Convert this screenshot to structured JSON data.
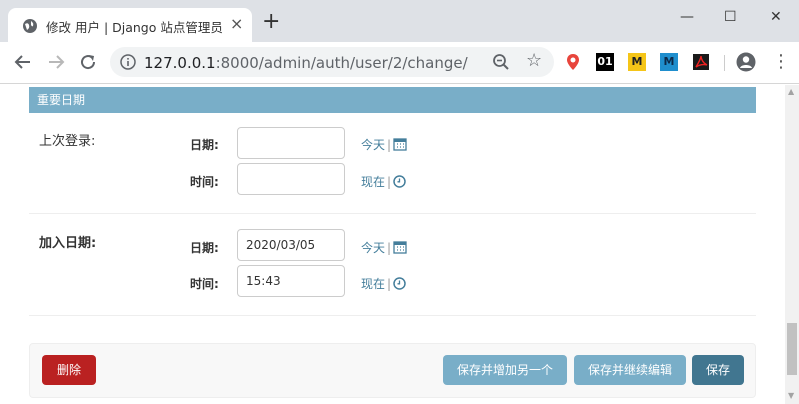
{
  "browser": {
    "tab_title": "修改 用户 | Django 站点管理员",
    "tab_close": "×",
    "new_tab": "+",
    "window": {
      "minimize": "—",
      "maximize": "☐",
      "close": "✕"
    },
    "url_host": "127.0.0.1",
    "url_rest": ":8000/admin/auth/user/2/change/",
    "extensions": [
      {
        "name": "01",
        "bg": "#000000",
        "fg": "#ffffff"
      },
      {
        "name": "M",
        "bg": "#f5c518",
        "fg": "#222222"
      },
      {
        "name": "M",
        "bg": "#1f8ecd",
        "fg": "#0b2a4a"
      }
    ]
  },
  "page": {
    "section_title": "重要日期",
    "last_login": {
      "label": "上次登录:",
      "date_label": "日期:",
      "time_label": "时间:",
      "date_value": "",
      "time_value": "",
      "today_link": "今天",
      "now_link": "现在"
    },
    "date_joined": {
      "label": "加入日期:",
      "date_label": "日期:",
      "time_label": "时间:",
      "date_value": "2020/03/05",
      "time_value": "15:43",
      "today_link": "今天",
      "now_link": "现在"
    },
    "pipe": "|",
    "buttons": {
      "delete": "删除",
      "save_add_another": "保存并增加另一个",
      "save_continue": "保存并继续编辑",
      "save": "保存"
    }
  },
  "colors": {
    "header_blue": "#79aec8",
    "link_blue": "#447e9b",
    "delete_red": "#ba2121",
    "save_dark": "#417690"
  }
}
